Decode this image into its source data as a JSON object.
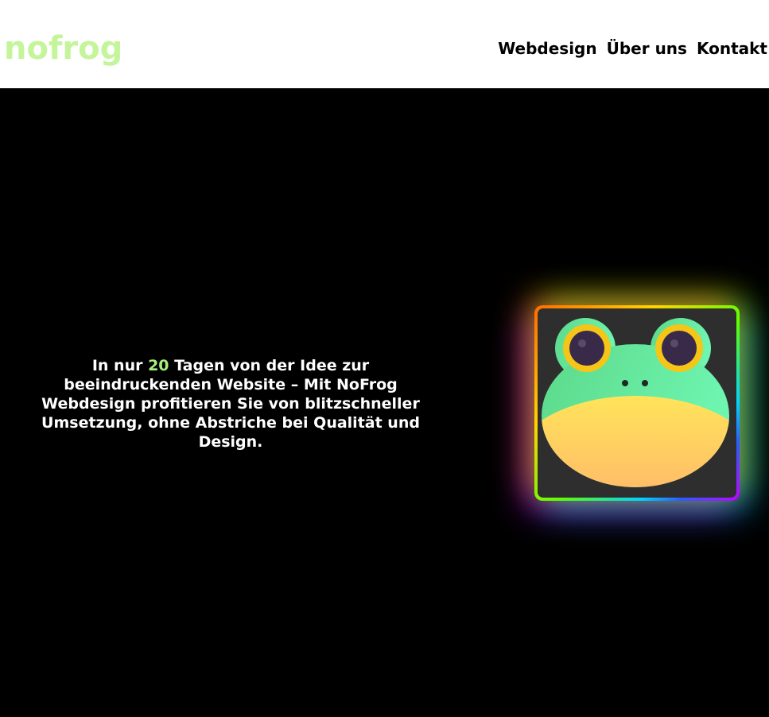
{
  "header": {
    "logo": "nofrog",
    "nav": {
      "webdesign": "Webdesign",
      "about": "Über uns",
      "contact": "Kontakt"
    }
  },
  "hero": {
    "text_before": "In nur ",
    "text_highlight": "20",
    "text_after": " Tagen von der Idee zur beeindruckenden Website – Mit NoFrog Webdesign profitieren Sie von blitzschneller Umsetzung, ohne Abstriche bei Qualität und Design.",
    "image_icon": "frog-icon"
  },
  "colors": {
    "logo": "#c4f59a",
    "highlight": "#a8f07a",
    "header_bg": "#ffffff",
    "hero_bg": "#000000"
  }
}
